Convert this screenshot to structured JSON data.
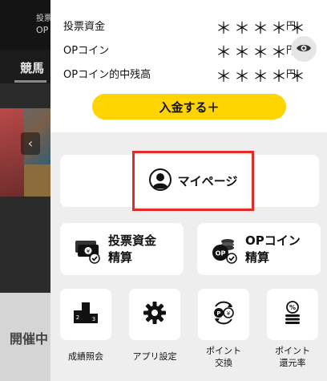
{
  "background": {
    "header_line1": "投票",
    "header_line2": "OP",
    "nav_first": "競馬",
    "arrow": "‹",
    "section_heading": "開催中"
  },
  "balances": [
    {
      "label": "投票資金",
      "masked": "＊＊＊＊＊",
      "unit": "円"
    },
    {
      "label": "OPコイン",
      "masked": "＊＊＊＊＊",
      "unit": "円"
    },
    {
      "label": "OPコイン的中残高",
      "masked": "＊＊＊＊＊",
      "unit": "円"
    }
  ],
  "deposit_button": "入金する＋",
  "mypage_label": "マイページ",
  "settle_cards": [
    {
      "line1": "投票資金",
      "line2": "精算",
      "icon": "yen-bills-check-icon"
    },
    {
      "line1": "OPコイン",
      "line2": "精算",
      "icon": "op-coins-check-icon"
    }
  ],
  "tiles": [
    {
      "label_line1": "成績照会",
      "label_line2": "",
      "icon": "podium-icon"
    },
    {
      "label_line1": "アプリ設定",
      "label_line2": "",
      "icon": "gear-icon"
    },
    {
      "label_line1": "ポイント",
      "label_line2": "交換",
      "icon": "point-exchange-icon"
    },
    {
      "label_line1": "ポイント",
      "label_line2": "還元率",
      "icon": "point-rate-icon"
    }
  ],
  "colors": {
    "accent_yellow": "#ffd400",
    "highlight_red": "#e52a2a",
    "drawer_bg": "#eeeeee"
  }
}
